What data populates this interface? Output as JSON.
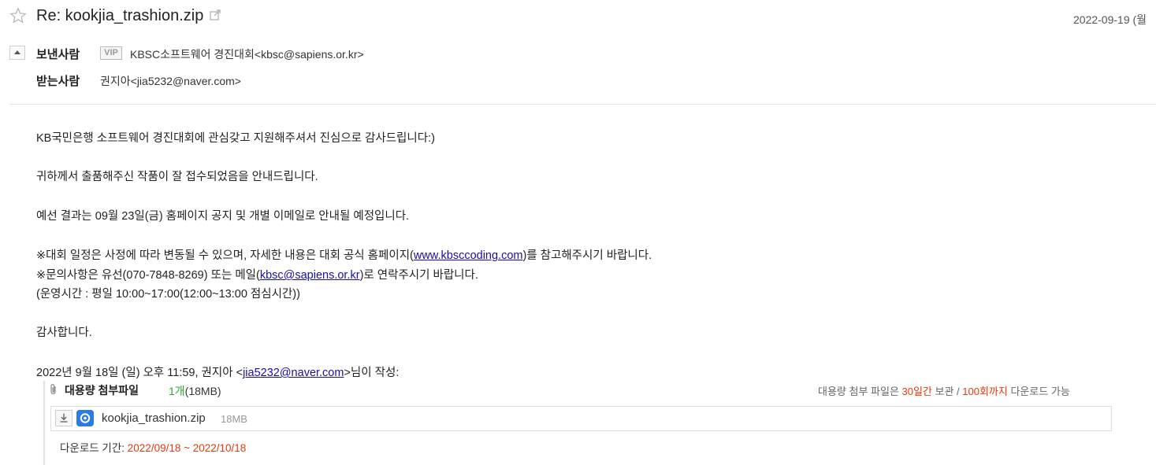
{
  "header": {
    "subject": "Re: kookjia_trashion.zip",
    "date": "2022-09-19 (월",
    "sender_label": "보낸사람",
    "vip_badge": "VIP",
    "sender": "KBSC소프트웨어 경진대회<kbsc@sapiens.or.kr>",
    "recipient_label": "받는사람",
    "recipient": "권지아<jia5232@naver.com>"
  },
  "body": {
    "line1": "KB국민은행 소프트웨어 경진대회에 관심갖고 지원해주셔서 진심으로 감사드립니다:)",
    "line2": "귀하께서 출품해주신 작품이 잘 접수되었음을 안내드립니다.",
    "line3": "예선 결과는 09월 23일(금) 홈페이지 공지 및 개별 이메일로 안내될 예정입니다.",
    "line4_pre": "※대회 일정은 사정에 따라 변동될 수 있으며, 자세한 내용은 대회 공식 홈페이지(",
    "line4_link": "www.kbsccoding.com",
    "line4_post": ")를 참고해주시기 바랍니다.",
    "line5_pre": "※문의사항은 유선(070-7848-8269) 또는 메일(",
    "line5_link": "kbsc@sapiens.or.kr",
    "line5_post": ")로 연락주시기 바랍니다.",
    "line6": "(운영시간 : 평일 10:00~17:00(12:00~13:00 점심시간))",
    "line7": "감사합니다.",
    "quote_pre": "2022년 9월 18일 (일) 오후 11:59, 권지아 <",
    "quote_link": "jia5232@naver.com",
    "quote_post": ">님이 작성:"
  },
  "attachment": {
    "title": "대용량 첨부파일",
    "count": "1개",
    "total_size": "(18MB)",
    "notice_pre": "대용량 첨부 파일은 ",
    "notice_days": "30일간",
    "notice_mid": " 보관 / ",
    "notice_times": "100회까지",
    "notice_post": " 다운로드 가능",
    "file_name": "kookjia_trashion.zip",
    "file_size": "18MB",
    "period_label": "다운로드 기간: ",
    "period_value": "2022/09/18 ~ 2022/10/18"
  },
  "colors": {
    "accent_red": "#e8380d",
    "accent_green": "#2ea72e",
    "link": "#1a0dab",
    "app_icon_blue": "#2d7be5"
  }
}
